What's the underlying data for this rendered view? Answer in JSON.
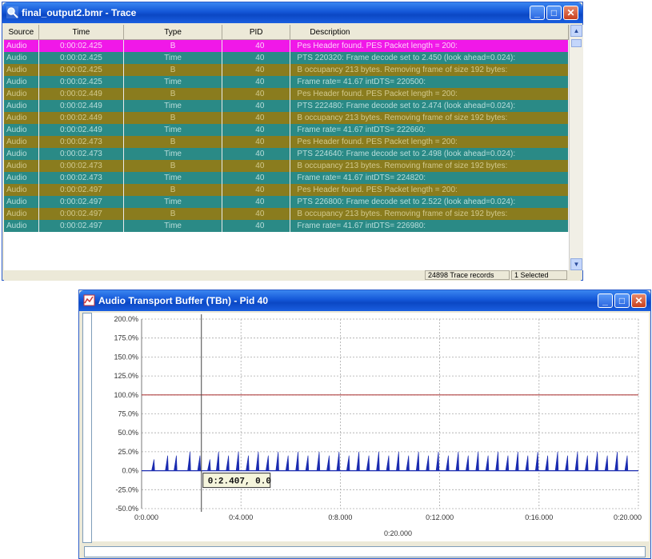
{
  "trace_window": {
    "title": "final_output2.bmr - Trace",
    "columns": [
      "Source",
      "Time",
      "Type",
      "PID",
      "Description"
    ],
    "rows": [
      {
        "source": "Audio",
        "time": "0:00:02.425",
        "type": "B",
        "pid": "40",
        "desc": "Pes Header found. PES Packet length = 200:",
        "style": "sel"
      },
      {
        "source": "Audio",
        "time": "0:00:02.425",
        "type": "Time",
        "pid": "40",
        "desc": "PTS 220320: Frame decode set to 2.450 (look ahead=0.024):",
        "style": "time"
      },
      {
        "source": "Audio",
        "time": "0:00:02.425",
        "type": "B",
        "pid": "40",
        "desc": "B occupancy 213 bytes. Removing frame of size 192 bytes:",
        "style": "b"
      },
      {
        "source": "Audio",
        "time": "0:00:02.425",
        "type": "Time",
        "pid": "40",
        "desc": "Frame rate= 41.67  intDTS= 220500:",
        "style": "time"
      },
      {
        "source": "Audio",
        "time": "0:00:02.449",
        "type": "B",
        "pid": "40",
        "desc": "Pes Header found. PES Packet length = 200:",
        "style": "b"
      },
      {
        "source": "Audio",
        "time": "0:00:02.449",
        "type": "Time",
        "pid": "40",
        "desc": "PTS 222480: Frame decode set to 2.474 (look ahead=0.024):",
        "style": "time"
      },
      {
        "source": "Audio",
        "time": "0:00:02.449",
        "type": "B",
        "pid": "40",
        "desc": "B occupancy 213 bytes. Removing frame of size 192 bytes:",
        "style": "b"
      },
      {
        "source": "Audio",
        "time": "0:00:02.449",
        "type": "Time",
        "pid": "40",
        "desc": "Frame rate= 41.67  intDTS= 222660:",
        "style": "time"
      },
      {
        "source": "Audio",
        "time": "0:00:02.473",
        "type": "B",
        "pid": "40",
        "desc": "Pes Header found. PES Packet length = 200:",
        "style": "b"
      },
      {
        "source": "Audio",
        "time": "0:00:02.473",
        "type": "Time",
        "pid": "40",
        "desc": "PTS 224640: Frame decode set to 2.498 (look ahead=0.024):",
        "style": "time"
      },
      {
        "source": "Audio",
        "time": "0:00:02.473",
        "type": "B",
        "pid": "40",
        "desc": "B occupancy 213 bytes. Removing frame of size 192 bytes:",
        "style": "b"
      },
      {
        "source": "Audio",
        "time": "0:00:02.473",
        "type": "Time",
        "pid": "40",
        "desc": "Frame rate= 41.67  intDTS= 224820:",
        "style": "time"
      },
      {
        "source": "Audio",
        "time": "0:00:02.497",
        "type": "B",
        "pid": "40",
        "desc": "Pes Header found. PES Packet length = 200:",
        "style": "b"
      },
      {
        "source": "Audio",
        "time": "0:00:02.497",
        "type": "Time",
        "pid": "40",
        "desc": "PTS 226800: Frame decode set to 2.522 (look ahead=0.024):",
        "style": "time"
      },
      {
        "source": "Audio",
        "time": "0:00:02.497",
        "type": "B",
        "pid": "40",
        "desc": "B occupancy 213 bytes. Removing frame of size 192 bytes:",
        "style": "b"
      },
      {
        "source": "Audio",
        "time": "0:00:02.497",
        "type": "Time",
        "pid": "40",
        "desc": "Frame rate= 41.67  intDTS= 226980:",
        "style": "time"
      }
    ],
    "status_records": "24898 Trace records",
    "status_selected": "1 Selected"
  },
  "buffer_window": {
    "title": "Audio Transport Buffer (TBn) - Pid 40",
    "cursor_tooltip": "0:2.407, 0.0"
  },
  "colors": {
    "selected_row": "#f018e8",
    "time_row": "#2a8a86",
    "b_row": "#8a7c1e",
    "limit_line": "#b04040",
    "series": "#1a2bb0"
  },
  "chart_data": {
    "type": "line",
    "title": "",
    "xlabel": "0:20.000",
    "ylabel": "",
    "xlim": [
      0,
      20
    ],
    "ylim": [
      -50,
      200
    ],
    "x_tick_labels": [
      "0:0.000",
      "0:4.000",
      "0:8.000",
      "0:12.000",
      "0:16.000",
      "0:20.000"
    ],
    "y_tick_labels": [
      "200.0%",
      "175.0%",
      "150.0%",
      "125.0%",
      "100.0%",
      "75.0%",
      "50.0%",
      "25.0%",
      "0.0%",
      "-25.0%",
      "-50.0%"
    ],
    "y_ticks": [
      200,
      175,
      150,
      125,
      100,
      75,
      50,
      25,
      0,
      -25,
      -50
    ],
    "grid": true,
    "reference_line": {
      "value": 100
    },
    "cursor_x": 2.407,
    "spike_times": [
      0.5,
      1.05,
      1.4,
      1.95,
      2.35,
      2.75,
      3.1,
      3.5,
      3.9,
      4.3,
      4.7,
      5.1,
      5.5,
      5.9,
      6.3,
      6.7,
      7.15,
      7.55,
      7.95,
      8.35,
      8.75,
      9.15,
      9.55,
      9.95,
      10.35,
      10.75,
      11.15,
      11.55,
      11.95,
      12.35,
      12.75,
      13.15,
      13.55,
      13.95,
      14.35,
      14.75,
      15.15,
      15.55,
      15.95,
      16.35,
      16.75,
      17.15,
      17.55,
      17.95,
      18.35,
      18.75,
      19.15,
      19.55
    ],
    "spike_peaks": [
      15,
      20,
      20,
      25,
      20,
      15,
      25,
      20,
      25,
      20,
      25,
      20,
      25,
      20,
      25,
      20,
      25,
      20,
      25,
      20,
      25,
      20,
      25,
      20,
      25,
      20,
      25,
      20,
      25,
      20,
      25,
      20,
      25,
      20,
      25,
      20,
      25,
      20,
      25,
      20,
      25,
      20,
      25,
      20,
      25,
      20,
      25,
      20
    ]
  }
}
